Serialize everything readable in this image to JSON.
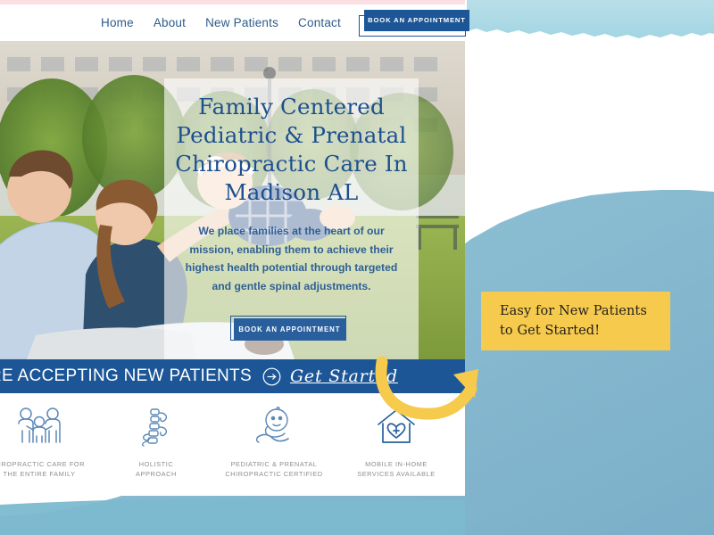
{
  "theme": {
    "brand_blue": "#1d5697",
    "text_blue": "#1c4f8f",
    "accent_yellow": "#f6ca4c",
    "pink_strip": "#fbdfe2",
    "torn_paper_light": "#a9d9e4",
    "torn_paper_mid": "#7cb4cd",
    "label_gray": "#8e8e93"
  },
  "nav": {
    "links": [
      {
        "label": "Home",
        "name": "nav-link-home"
      },
      {
        "label": "About",
        "name": "nav-link-about"
      },
      {
        "label": "New Patients",
        "name": "nav-link-new-patients"
      },
      {
        "label": "Contact",
        "name": "nav-link-contact"
      }
    ],
    "cta_label": "BOOK AN APPOINTMENT"
  },
  "hero": {
    "title": "Family Centered Pediatric & Prenatal Chiropractic Care In Madison AL",
    "subtitle": "We place families at the heart of our mission, enabling them to achieve their highest health potential through targeted and gentle spinal adjustments.",
    "cta_label": "BOOK AN APPOINTMENT",
    "photo_alt": "family-with-baby-in-park-photo"
  },
  "banner": {
    "text": "RE ACCEPTING NEW PATIENTS",
    "arrow_icon": "circle-arrow-right-icon",
    "link_label": "Get Started"
  },
  "features": [
    {
      "icon": "family-group-icon",
      "label": "HIROPRACTIC CARE FOR\nTHE ENTIRE FAMILY"
    },
    {
      "icon": "spine-icon",
      "label": "HOLISTIC\nAPPROACH"
    },
    {
      "icon": "baby-in-hand-icon",
      "label": "PEDIATRIC & PRENATAL\nCHIROPRACTIC CERTIFIED"
    },
    {
      "icon": "house-heart-icon",
      "label": "MOBILE IN-HOME\nSERVICES AVAILABLE"
    }
  ],
  "annotation": {
    "line1": "Easy for New Patients",
    "line2": "to Get Started!",
    "arrow_icon": "curved-arrow-up-right-icon"
  }
}
